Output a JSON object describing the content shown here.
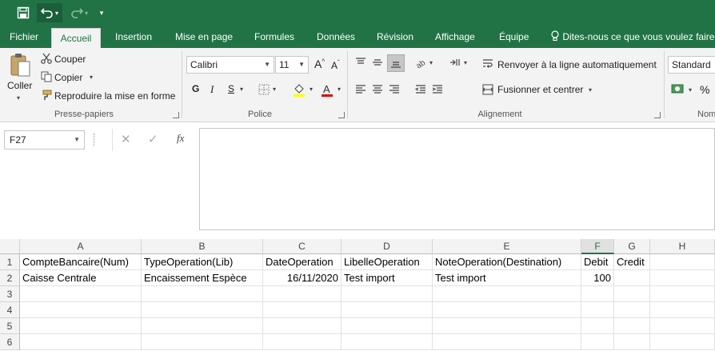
{
  "colors": {
    "brand": "#217346",
    "ribbon_bg": "#f3f3f3"
  },
  "tabs": [
    "Fichier",
    "Accueil",
    "Insertion",
    "Mise en page",
    "Formules",
    "Données",
    "Révision",
    "Affichage",
    "Équipe"
  ],
  "tell_me": "Dites-nous ce que vous voulez faire.",
  "clipboard": {
    "paste": "Coller",
    "cut": "Couper",
    "copy": "Copier",
    "format_painter": "Reproduire la mise en forme",
    "label": "Presse-papiers"
  },
  "font": {
    "name": "Calibri",
    "size": "11",
    "bold": "G",
    "italic": "I",
    "underline": "S",
    "label": "Police"
  },
  "alignment": {
    "wrap": "Renvoyer à la ligne automatiquement",
    "merge": "Fusionner et centrer",
    "label": "Alignement"
  },
  "number": {
    "format": "Standard",
    "percent": "%",
    "label": "Nom"
  },
  "formula_bar": {
    "name_box": "F27",
    "fx": "fx"
  },
  "columns": [
    "A",
    "B",
    "C",
    "D",
    "E",
    "F",
    "G",
    "H"
  ],
  "rows": [
    "1",
    "2",
    "3",
    "4",
    "5",
    "6"
  ],
  "cells": {
    "r1": [
      "CompteBancaire(Num)",
      "TypeOperation(Lib)",
      "DateOperation",
      "LibelleOperation",
      "NoteOperation(Destination)",
      "Debit",
      "Credit",
      ""
    ],
    "r2": [
      "Caisse Centrale",
      "Encaissement Espèce",
      "16/11/2020",
      "Test import",
      "Test import",
      "100",
      "",
      ""
    ]
  }
}
